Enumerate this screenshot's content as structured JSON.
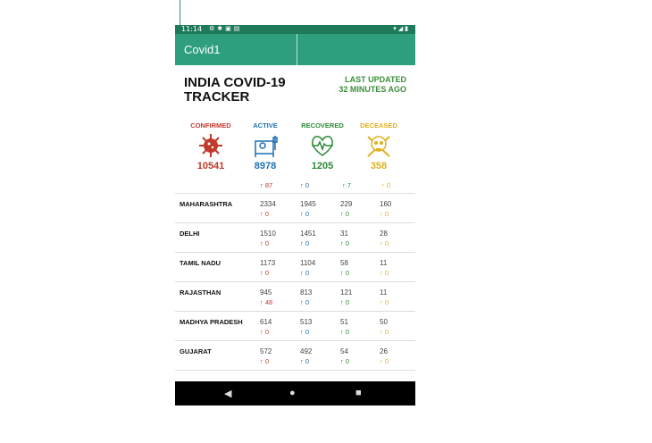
{
  "status_bar": {
    "time": "11:14"
  },
  "app_bar": {
    "title": "Covid1"
  },
  "header": {
    "title": "INDIA COVID-19 TRACKER",
    "updated_line1": "LAST UPDATED",
    "updated_line2": "32 MINUTES AGO"
  },
  "stats": [
    {
      "label": "CONFIRMED",
      "value": "10541",
      "delta": "↑ 87",
      "color": "#c0392b",
      "icon": "virus-icon"
    },
    {
      "label": "ACTIVE",
      "value": "8978",
      "delta": "↑ 0",
      "color": "#1f6fb2",
      "icon": "patient-bed-icon"
    },
    {
      "label": "RECOVERED",
      "value": "1205",
      "delta": "↑ 7",
      "color": "#2e8b3a",
      "icon": "heartbeat-icon"
    },
    {
      "label": "DECEASED",
      "value": "358",
      "delta": "↑ 0",
      "color": "#e0b020",
      "icon": "skull-crossbones-icon"
    }
  ],
  "states": [
    {
      "name": "MAHARASHTRA",
      "confirmed": "2334",
      "active": "1945",
      "recovered": "229",
      "deceased": "160",
      "d_confirmed": "↑ 0",
      "d_active": "↑ 0",
      "d_recovered": "↑ 0",
      "d_deceased": "↑ 0"
    },
    {
      "name": "DELHI",
      "confirmed": "1510",
      "active": "1451",
      "recovered": "31",
      "deceased": "28",
      "d_confirmed": "↑ 0",
      "d_active": "↑ 0",
      "d_recovered": "↑ 0",
      "d_deceased": "↑ 0"
    },
    {
      "name": "TAMIL NADU",
      "confirmed": "1173",
      "active": "1104",
      "recovered": "58",
      "deceased": "11",
      "d_confirmed": "↑ 0",
      "d_active": "↑ 0",
      "d_recovered": "↑ 0",
      "d_deceased": "↑ 0"
    },
    {
      "name": "RAJASTHAN",
      "confirmed": "945",
      "active": "813",
      "recovered": "121",
      "deceased": "11",
      "d_confirmed": "↑ 48",
      "d_active": "↑ 0",
      "d_recovered": "↑ 0",
      "d_deceased": "↑ 0"
    },
    {
      "name": "MADHYA PRADESH",
      "confirmed": "614",
      "active": "513",
      "recovered": "51",
      "deceased": "50",
      "d_confirmed": "↑ 0",
      "d_active": "↑ 0",
      "d_recovered": "↑ 0",
      "d_deceased": "↑ 0"
    },
    {
      "name": "GUJARAT",
      "confirmed": "572",
      "active": "492",
      "recovered": "54",
      "deceased": "26",
      "d_confirmed": "↑ 0",
      "d_active": "↑ 0",
      "d_recovered": "↑ 0",
      "d_deceased": "↑ 0"
    }
  ],
  "nav": {
    "back_icon": "back-triangle-icon",
    "home_icon": "home-circle-icon",
    "recents_icon": "recents-square-icon"
  }
}
